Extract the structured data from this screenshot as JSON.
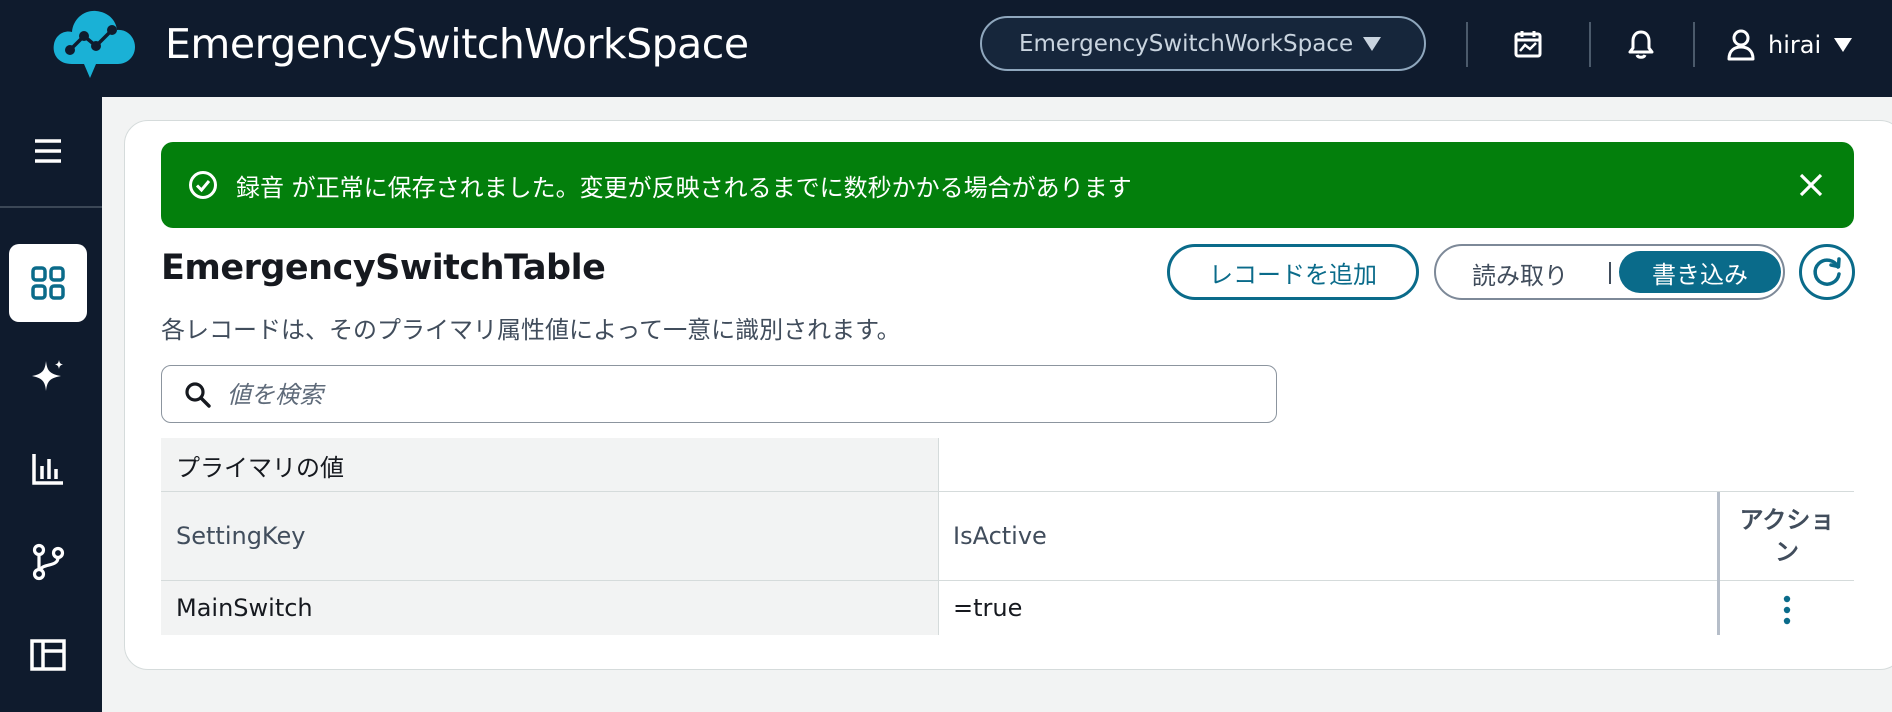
{
  "header": {
    "app_title": "EmergencySwitchWorkSpace",
    "workspace_selector": "EmergencySwitchWorkSpace",
    "user_name": "hirai"
  },
  "flash": {
    "message": "録音 が正常に保存されました。変更が反映されるまでに数秒かかる場合があります",
    "color": "#037f0c"
  },
  "table": {
    "title": "EmergencySwitchTable",
    "description": "各レコードは、そのプライマリ属性値によって一意に識別されます。",
    "add_record_label": "レコードを追加",
    "mode_read_label": "読み取り",
    "mode_write_label": "書き込み",
    "search_placeholder": "値を検索",
    "group_header": "プライマリの値",
    "columns": [
      "SettingKey",
      "IsActive",
      "アクション"
    ],
    "rows": [
      {
        "SettingKey": "MainSwitch",
        "IsActive": "=true"
      }
    ]
  },
  "colors": {
    "topbar": "#0f1b2d",
    "accent": "#0a6b8a",
    "logo": "#1ab1d6"
  },
  "icons": {
    "logo": "cloud-network-logo-icon",
    "calendar": "calendar-chart-icon",
    "bell": "bell-icon",
    "user": "user-icon",
    "menu": "hamburger-menu-icon",
    "dashboard": "dashboard-grid-icon",
    "sparkle": "sparkle-icon",
    "chart": "bar-chart-icon",
    "branch": "git-branch-icon",
    "table": "table-layout-icon",
    "success": "check-circle-icon",
    "close": "close-icon",
    "refresh": "refresh-icon",
    "search": "search-icon",
    "kebab": "kebab-menu-icon"
  }
}
